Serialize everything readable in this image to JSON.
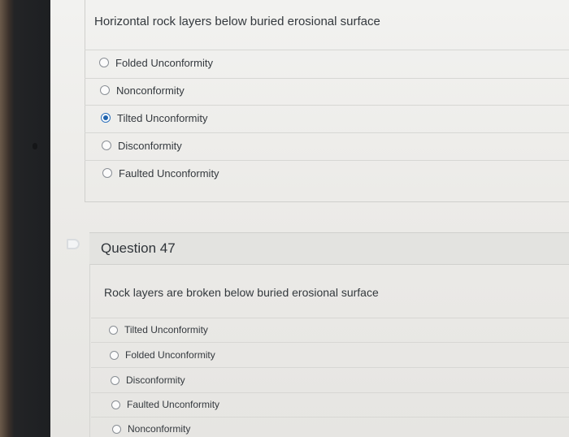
{
  "q46": {
    "prompt": "Horizontal rock layers below buried erosional surface",
    "options": [
      {
        "label": "Folded Unconformity",
        "selected": false
      },
      {
        "label": "Nonconformity",
        "selected": false
      },
      {
        "label": "Tilted Unconformity",
        "selected": true
      },
      {
        "label": "Disconformity",
        "selected": false
      },
      {
        "label": "Faulted Unconformity",
        "selected": false
      }
    ]
  },
  "q47": {
    "title": "Question 47",
    "prompt": "Rock layers are broken below buried erosional surface",
    "options": [
      {
        "label": "Tilted Unconformity",
        "selected": false
      },
      {
        "label": "Folded Unconformity",
        "selected": false
      },
      {
        "label": "Disconformity",
        "selected": false
      },
      {
        "label": "Faulted Unconformity",
        "selected": false
      },
      {
        "label": "Nonconformity",
        "selected": false
      }
    ]
  }
}
